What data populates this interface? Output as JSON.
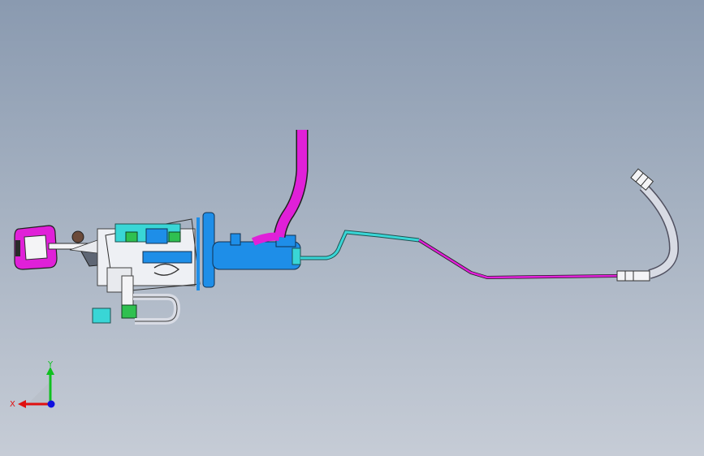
{
  "colors": {
    "background_top": "#8a9ab0",
    "background_bottom": "#c6ccd6",
    "magenta": "#e020d8",
    "blue": "#1e8ee8",
    "cyan": "#39d6d6",
    "green": "#2fc050",
    "white_part": "#f4f4f6",
    "grey_tube": "#d8dbe4"
  },
  "model": {
    "parts": [
      "pedal-pad-icon",
      "pedal-arm-icon",
      "pedal-bracket-icon",
      "master-cylinder-icon",
      "reservoir-hose-icon",
      "hydraulic-line-icon",
      "flex-hose-icon",
      "hose-fitting-icon"
    ]
  },
  "triad": {
    "x_label": "X",
    "y_label": "Y",
    "x_color": "#e01010",
    "y_color": "#10c020",
    "z_color": "#1010e0"
  }
}
